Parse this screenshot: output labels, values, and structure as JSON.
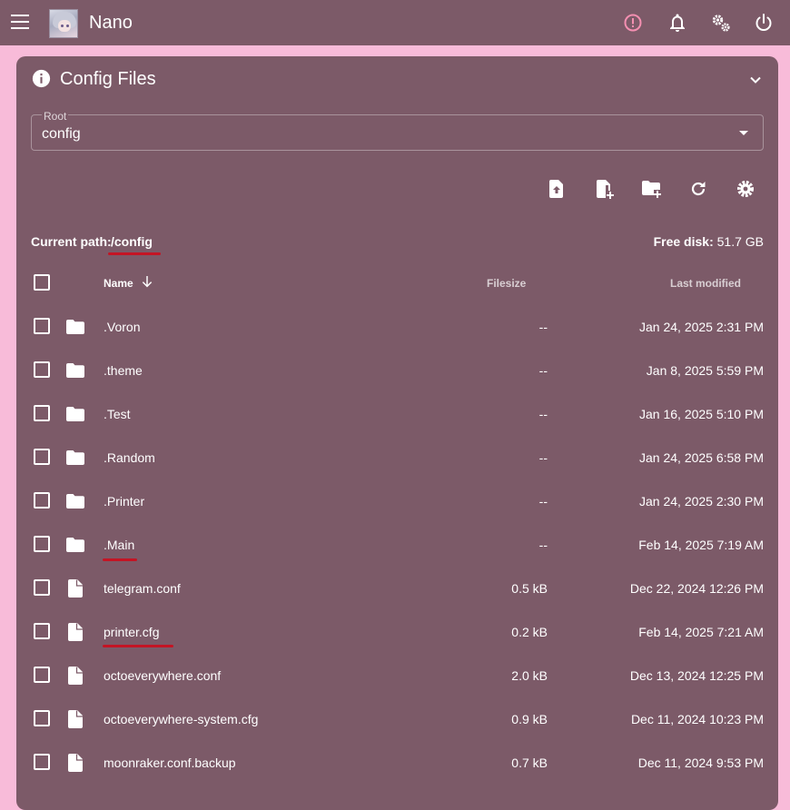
{
  "app": {
    "title": "Nano",
    "icons": [
      "menu-icon",
      "avatar",
      "warning-icon",
      "bell-icon",
      "gears-icon",
      "power-icon"
    ],
    "colors": {
      "background": "#f8bbd9",
      "surface": "#7c5a68",
      "warning": "#f48fb1",
      "annotation": "#c41424"
    }
  },
  "panel": {
    "title": "Config Files",
    "root": {
      "label": "Root",
      "value": "config"
    },
    "toolbar": [
      "upload-file-icon",
      "create-file-icon",
      "create-folder-icon",
      "refresh-icon",
      "settings-icon"
    ],
    "current_path_label": "Current path:",
    "current_path": "/config",
    "free_disk_label": "Free disk:",
    "free_disk_value": "51.7 GB"
  },
  "table": {
    "headers": {
      "name": "Name",
      "filesize": "Filesize",
      "last_modified": "Last modified"
    },
    "sort": "descending-arrow",
    "rows": [
      {
        "type": "folder",
        "name": ".Voron",
        "size": "--",
        "modified": "Jan 24, 2025 2:31 PM"
      },
      {
        "type": "folder",
        "name": ".theme",
        "size": "--",
        "modified": "Jan 8, 2025 5:59 PM"
      },
      {
        "type": "folder",
        "name": ".Test",
        "size": "--",
        "modified": "Jan 16, 2025 5:10 PM"
      },
      {
        "type": "folder",
        "name": ".Random",
        "size": "--",
        "modified": "Jan 24, 2025 6:58 PM"
      },
      {
        "type": "folder",
        "name": ".Printer",
        "size": "--",
        "modified": "Jan 24, 2025 2:30 PM"
      },
      {
        "type": "folder",
        "name": ".Main",
        "size": "--",
        "modified": "Feb 14, 2025 7:19 AM"
      },
      {
        "type": "file",
        "name": "telegram.conf",
        "size": "0.5 kB",
        "modified": "Dec 22, 2024 12:26 PM"
      },
      {
        "type": "file",
        "name": "printer.cfg",
        "size": "0.2 kB",
        "modified": "Feb 14, 2025 7:21 AM"
      },
      {
        "type": "file",
        "name": "octoeverywhere.conf",
        "size": "2.0 kB",
        "modified": "Dec 13, 2024 12:25 PM"
      },
      {
        "type": "file",
        "name": "octoeverywhere-system.cfg",
        "size": "0.9 kB",
        "modified": "Dec 11, 2024 10:23 PM"
      },
      {
        "type": "file",
        "name": "moonraker.conf.backup",
        "size": "0.7 kB",
        "modified": "Dec 11, 2024 9:53 PM"
      }
    ]
  }
}
